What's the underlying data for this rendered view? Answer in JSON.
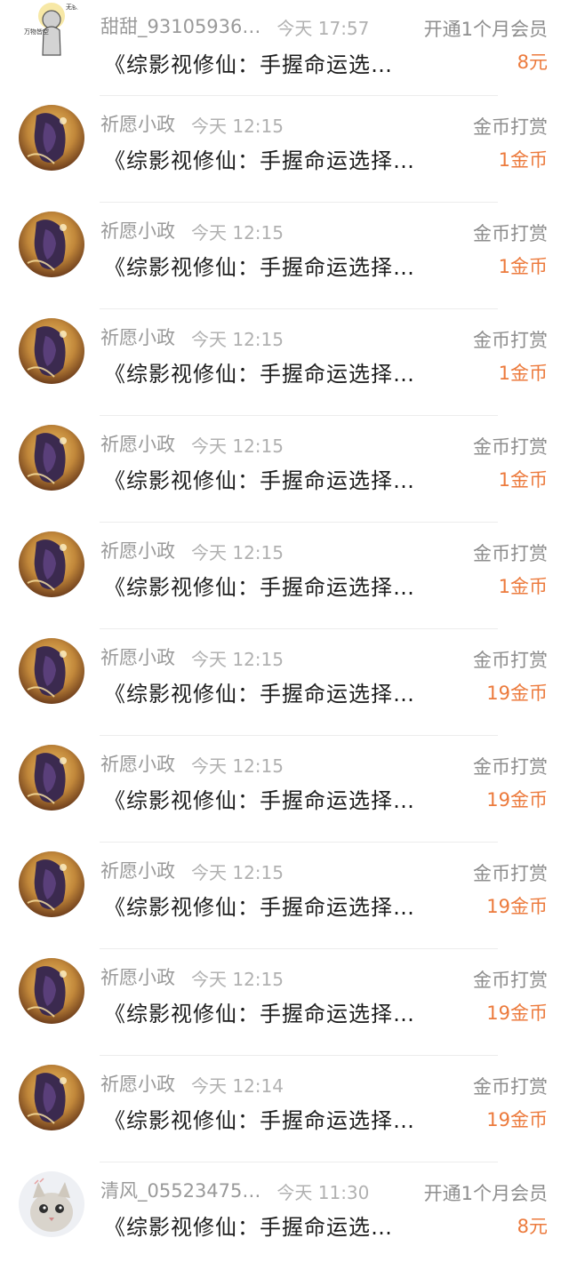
{
  "colors": {
    "amount": "#ec7a3c",
    "name": "#9a9a9a",
    "title": "#1e1e1e",
    "divider": "#ececec"
  },
  "records": [
    {
      "avatar": "tiantian-avatar",
      "name": "甜甜_93105936…",
      "time": "今天 17:57",
      "title": "《综影视修仙：手握命运选…",
      "type": "开通1个月会员",
      "amount": "8元"
    },
    {
      "avatar": "qiyuan-avatar",
      "name": "祈愿小政",
      "time": "今天 12:15",
      "title": "《综影视修仙：手握命运选择…",
      "type": "金币打赏",
      "amount": "1金币"
    },
    {
      "avatar": "qiyuan-avatar",
      "name": "祈愿小政",
      "time": "今天 12:15",
      "title": "《综影视修仙：手握命运选择…",
      "type": "金币打赏",
      "amount": "1金币"
    },
    {
      "avatar": "qiyuan-avatar",
      "name": "祈愿小政",
      "time": "今天 12:15",
      "title": "《综影视修仙：手握命运选择…",
      "type": "金币打赏",
      "amount": "1金币"
    },
    {
      "avatar": "qiyuan-avatar",
      "name": "祈愿小政",
      "time": "今天 12:15",
      "title": "《综影视修仙：手握命运选择…",
      "type": "金币打赏",
      "amount": "1金币"
    },
    {
      "avatar": "qiyuan-avatar",
      "name": "祈愿小政",
      "time": "今天 12:15",
      "title": "《综影视修仙：手握命运选择…",
      "type": "金币打赏",
      "amount": "1金币"
    },
    {
      "avatar": "qiyuan-avatar",
      "name": "祈愿小政",
      "time": "今天 12:15",
      "title": "《综影视修仙：手握命运选择…",
      "type": "金币打赏",
      "amount": "19金币"
    },
    {
      "avatar": "qiyuan-avatar",
      "name": "祈愿小政",
      "time": "今天 12:15",
      "title": "《综影视修仙：手握命运选择…",
      "type": "金币打赏",
      "amount": "19金币"
    },
    {
      "avatar": "qiyuan-avatar",
      "name": "祈愿小政",
      "time": "今天 12:15",
      "title": "《综影视修仙：手握命运选择…",
      "type": "金币打赏",
      "amount": "19金币"
    },
    {
      "avatar": "qiyuan-avatar",
      "name": "祈愿小政",
      "time": "今天 12:15",
      "title": "《综影视修仙：手握命运选择…",
      "type": "金币打赏",
      "amount": "19金币"
    },
    {
      "avatar": "qiyuan-avatar",
      "name": "祈愿小政",
      "time": "今天 12:14",
      "title": "《综影视修仙：手握命运选择…",
      "type": "金币打赏",
      "amount": "19金币"
    },
    {
      "avatar": "qingfeng-avatar",
      "name": "清风_05523475…",
      "time": "今天 11:30",
      "title": "《综影视修仙：手握命运选…",
      "type": "开通1个月会员",
      "amount": "8元"
    }
  ],
  "avatar_text": {
    "tiantian_left": "万物皆空",
    "tiantian_right": "无欲无求"
  }
}
